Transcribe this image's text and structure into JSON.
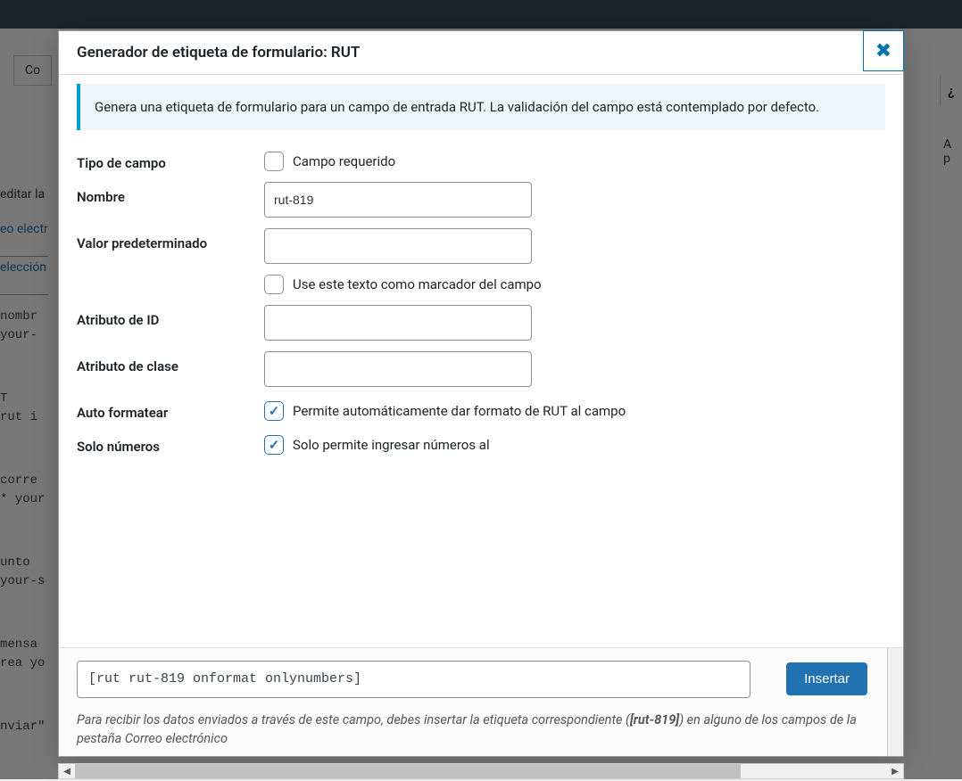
{
  "bg": {
    "tab1": "Co",
    "editar": "editar la",
    "link1": "eo electr",
    "link2": "elección",
    "code1a": " nombr",
    "code1b": "your-",
    "code2a": "T",
    "code2b": "rut i",
    "code3a": " corre",
    "code3b": "* your",
    "code4a": "unto",
    "code4b": "your-s",
    "code5a": " mensa",
    "code5b": "rea yo",
    "code6": "nviar\"",
    "right1": "¿",
    "right2a": "A",
    "right2b": "p"
  },
  "modal": {
    "title": "Generador de etiqueta de formulario: RUT",
    "info": "Genera una etiqueta de formulario para un campo de entrada RUT. La validación del campo está contemplado por defecto.",
    "fields": {
      "tipo_label": "Tipo de campo",
      "tipo_cb_label": "Campo requerido",
      "nombre_label": "Nombre",
      "nombre_value": "rut-819",
      "valor_label": "Valor predeterminado",
      "valor_value": "",
      "valor_cb_label": "Use este texto como marcador del campo",
      "id_label": "Atributo de ID",
      "id_value": "",
      "clase_label": "Atributo de clase",
      "clase_value": "",
      "auto_label": "Auto formatear",
      "auto_cb_label": "Permite automáticamente dar formato de RUT al campo",
      "solo_label": "Solo números",
      "solo_cb_label": "Solo permite ingresar números al"
    },
    "footer": {
      "code": "[rut rut-819 onformat onlynumbers]",
      "insert": "Insertar",
      "note_pre": "Para recibir los datos enviados a través de este campo, debes insertar la etiqueta correspondiente (",
      "note_strong": "[rut-819]",
      "note_post": ") en alguno de los campos de la pestaña Correo electrónico"
    }
  }
}
